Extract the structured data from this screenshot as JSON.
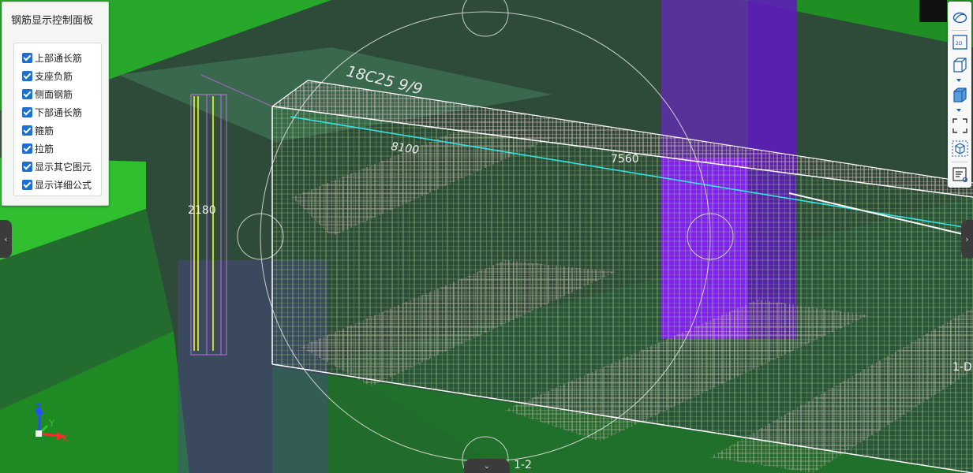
{
  "panel": {
    "title": "钢筋显示控制面板",
    "options": [
      {
        "label": "上部通长筋",
        "checked": true
      },
      {
        "label": "支座负筋",
        "checked": true
      },
      {
        "label": "侧面钢筋",
        "checked": true
      },
      {
        "label": "下部通长筋",
        "checked": true
      },
      {
        "label": "箍筋",
        "checked": true
      },
      {
        "label": "拉筋",
        "checked": true
      },
      {
        "label": "显示其它图元",
        "checked": true
      },
      {
        "label": "显示详细公式",
        "checked": true
      }
    ]
  },
  "annotations": {
    "rebar_spec": "18C25 9/9",
    "length_top": "8100",
    "length_right": "7560",
    "height": "2180",
    "axis_label": "1-D",
    "grid_label": "1-2"
  },
  "axes": {
    "z": "Z",
    "y": "Y",
    "x": "X"
  },
  "toolbar": {
    "buttons": [
      "orbit-icon",
      "2d-view-icon",
      "box-view-icon",
      "box-solid-icon",
      "fit-extent-icon",
      "cube-select-icon",
      "detail-list-icon"
    ],
    "view_2d_label": "2D"
  },
  "side_tabs": {
    "left": "‹",
    "right": "›",
    "bottom": "⌄"
  },
  "colors": {
    "accent": "#1f6fd0",
    "rebar_green": "#8fdc6a",
    "rebar_pink": "#d9b8b8",
    "column_purple": "#8a1cff",
    "dim_text_green": "#3fd13f",
    "top_bar_cyan": "#35e3e3"
  }
}
